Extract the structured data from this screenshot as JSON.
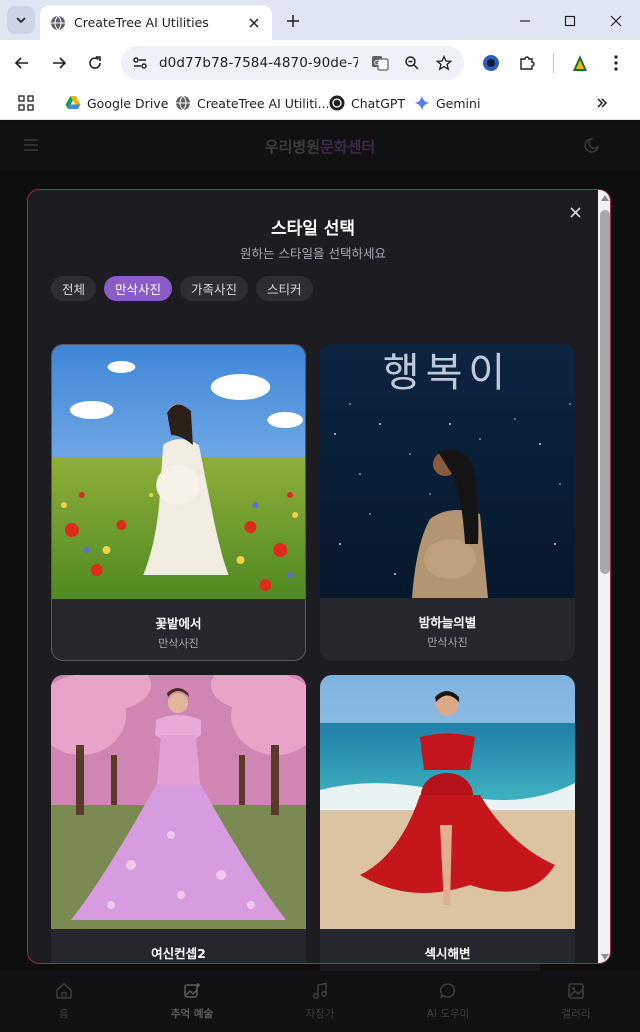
{
  "browser": {
    "tab_title": "CreateTree AI Utilities",
    "url": "d0d77b78-7584-4870-90de-7...",
    "bookmarks": [
      {
        "label": "Google Drive",
        "icon": "google-drive-icon"
      },
      {
        "label": "CreateTree AI Utiliti...",
        "icon": "globe-icon"
      },
      {
        "label": "ChatGPT",
        "icon": "chatgpt-icon"
      },
      {
        "label": "Gemini",
        "icon": "gemini-icon"
      }
    ]
  },
  "app": {
    "brand_main": "우리병원",
    "brand_accent": "문화센터"
  },
  "modal": {
    "title": "스타일 선택",
    "subtitle": "원하는 스타일을 선택하세요",
    "filters": [
      {
        "label": "전체",
        "active": false
      },
      {
        "label": "만삭사진",
        "active": true
      },
      {
        "label": "가족사진",
        "active": false
      },
      {
        "label": "스티커",
        "active": false
      }
    ],
    "cards": [
      {
        "title": "꽃밭에서",
        "category": "만삭사진",
        "image": "pregnant woman in white dress in flower meadow"
      },
      {
        "title": "밤하늘의별",
        "category": "만삭사진",
        "image": "pregnant woman under starry night sky",
        "overlay_text": "행복이"
      },
      {
        "title": "여신컨셉2",
        "category": "",
        "image": "woman in pink ball gown among cherry blossoms"
      },
      {
        "title": "섹시해변",
        "category": "",
        "image": "pregnant woman in red dress on beach"
      }
    ]
  },
  "bottom_nav": [
    {
      "label": "홈",
      "icon": "home-icon"
    },
    {
      "label": "추억 예술",
      "icon": "image-plus-icon",
      "active": true
    },
    {
      "label": "자장가",
      "icon": "music-icon"
    },
    {
      "label": "AI 도우미",
      "icon": "chat-bubble-icon"
    },
    {
      "label": "갤러리",
      "icon": "gallery-icon"
    }
  ],
  "colors": {
    "accent": "#8b5cc7",
    "modal_border": "#9c2a48",
    "modal_bg": "#1c1c21"
  }
}
